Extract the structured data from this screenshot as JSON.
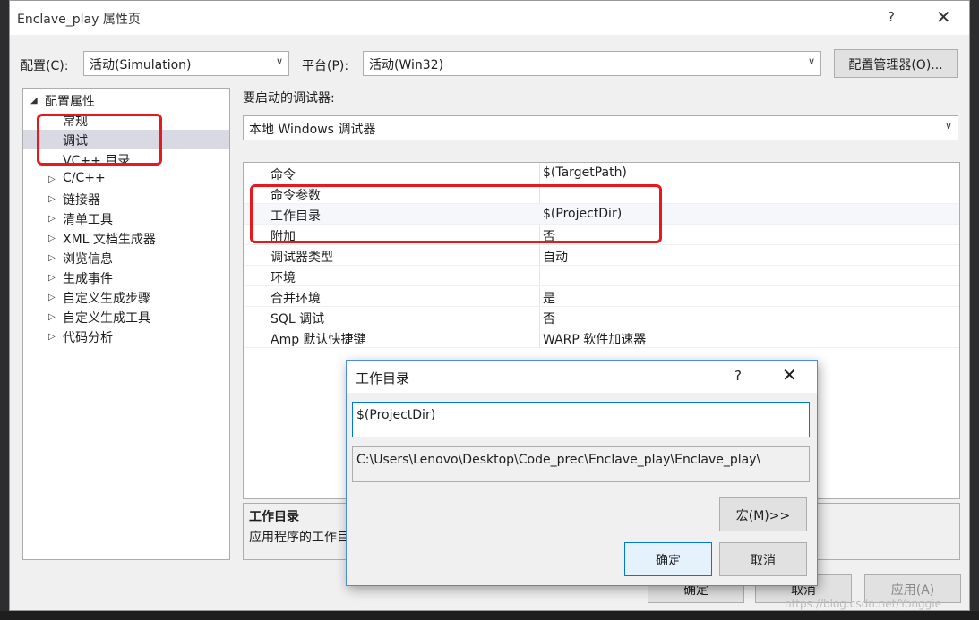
{
  "window": {
    "title": "Enclave_play 属性页",
    "help": "?",
    "close": "✕"
  },
  "config": {
    "label": "配置(C):",
    "value": "活动(Simulation)"
  },
  "platform": {
    "label": "平台(P):",
    "value": "活动(Win32)"
  },
  "config_manager_button": "配置管理器(O)...",
  "debugger": {
    "label": "要启动的调试器:",
    "value": "本地 Windows 调试器"
  },
  "tree": {
    "root": "配置属性",
    "items": [
      "常规",
      "调试",
      "VC++ 目录",
      "C/C++",
      "链接器",
      "清单工具",
      "XML 文档生成器",
      "浏览信息",
      "生成事件",
      "自定义生成步骤",
      "自定义生成工具",
      "代码分析"
    ]
  },
  "properties": [
    {
      "key": "命令",
      "value": "$(TargetPath)"
    },
    {
      "key": "命令参数",
      "value": ""
    },
    {
      "key": "工作目录",
      "value": "$(ProjectDir)"
    },
    {
      "key": "附加",
      "value": "否"
    },
    {
      "key": "调试器类型",
      "value": "自动"
    },
    {
      "key": "环境",
      "value": ""
    },
    {
      "key": "合并环境",
      "value": "是"
    },
    {
      "key": "SQL 调试",
      "value": "否"
    },
    {
      "key": "Amp 默认快捷键",
      "value": "WARP 软件加速器"
    }
  ],
  "description": {
    "title": "工作目录",
    "body": "应用程序的工作目"
  },
  "bottom_buttons": {
    "ok": "确定",
    "cancel": "取消",
    "apply": "应用(A)"
  },
  "dialog": {
    "title": "工作目录",
    "help": "?",
    "close": "✕",
    "input_value": "$(ProjectDir)",
    "evaluated": "C:\\Users\\Lenovo\\Desktop\\Code_prec\\Enclave_play\\Enclave_play\\",
    "macro_button": "宏(M)>>",
    "ok": "确定",
    "cancel": "取消"
  },
  "watermark": "https://blog.csdn.net/Yonggie"
}
